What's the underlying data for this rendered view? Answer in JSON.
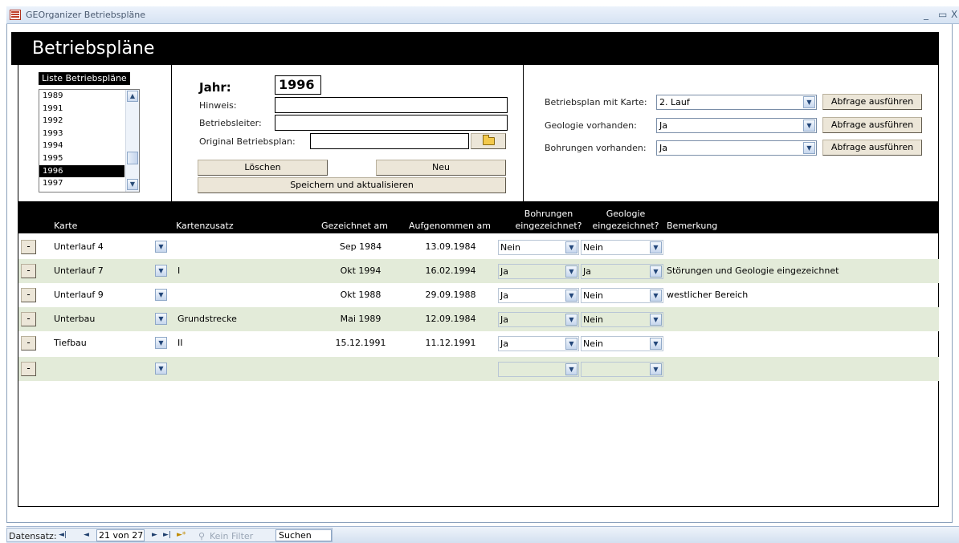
{
  "window": {
    "title": "GEOrganizer Betriebspläne",
    "minimize": "_",
    "maximize": "▭",
    "close": "X"
  },
  "header": {
    "title": "Betriebspläne"
  },
  "year_list": {
    "caption": "Liste Betriebspläne",
    "items": [
      "1989",
      "1991",
      "1992",
      "1993",
      "1994",
      "1995",
      "1996",
      "1997"
    ],
    "selected": "1996"
  },
  "form": {
    "year_label": "Jahr:",
    "year_value": "1996",
    "hinweis_label": "Hinweis:",
    "hinweis_value": "",
    "betriebsleiter_label": "Betriebsleiter:",
    "betriebsleiter_value": "",
    "original_label": "Original Betriebsplan:",
    "original_value": "",
    "delete_label": "Löschen",
    "new_label": "Neu",
    "save_label": "Speichern und aktualisieren"
  },
  "queries": [
    {
      "label": "Betriebsplan mit Karte:",
      "value": "2. Lauf",
      "button": "Abfrage ausführen"
    },
    {
      "label": "Geologie vorhanden:",
      "value": "Ja",
      "button": "Abfrage ausführen"
    },
    {
      "label": "Bohrungen vorhanden:",
      "value": "Ja",
      "button": "Abfrage ausführen"
    }
  ],
  "table": {
    "columns": {
      "karte": "Karte",
      "zusatz": "Kartenzusatz",
      "gezeichnet": "Gezeichnet am",
      "aufgenommen": "Aufgenommen am",
      "bohrungen_1": "Bohrungen",
      "bohrungen_2": "eingezeichnet?",
      "geologie_1": "Geologie",
      "geologie_2": "eingezeichnet?",
      "bemerkung": "Bemerkung"
    },
    "delete_glyph": "-",
    "rows": [
      {
        "karte": "Unterlauf 4",
        "zusatz": "",
        "gezeichnet": "Sep 1984",
        "aufgenommen": "13.09.1984",
        "bohrungen": "Nein",
        "geologie": "Nein",
        "bemerkung": ""
      },
      {
        "karte": "Unterlauf 7",
        "zusatz": "I",
        "gezeichnet": "Okt 1994",
        "aufgenommen": "16.02.1994",
        "bohrungen": "Ja",
        "geologie": "Ja",
        "bemerkung": "Störungen und Geologie eingezeichnet"
      },
      {
        "karte": "Unterlauf 9",
        "zusatz": "",
        "gezeichnet": "Okt 1988",
        "aufgenommen": "29.09.1988",
        "bohrungen": "Ja",
        "geologie": "Nein",
        "bemerkung": "westlicher Bereich"
      },
      {
        "karte": "Unterbau",
        "zusatz": "Grundstrecke",
        "gezeichnet": "Mai 1989",
        "aufgenommen": "12.09.1984",
        "bohrungen": "Ja",
        "geologie": "Nein",
        "bemerkung": ""
      },
      {
        "karte": "Tiefbau",
        "zusatz": "II",
        "gezeichnet": "15.12.1991",
        "aufgenommen": "11.12.1991",
        "bohrungen": "Ja",
        "geologie": "Nein",
        "bemerkung": ""
      },
      {
        "karte": "",
        "zusatz": "",
        "gezeichnet": "",
        "aufgenommen": "",
        "bohrungen": "",
        "geologie": "",
        "bemerkung": ""
      }
    ]
  },
  "statusbar": {
    "label": "Datensatz:",
    "first": "◄|",
    "prev": "◄",
    "record": "21 von 27",
    "next": "►",
    "last": "►|",
    "new": "►*",
    "filter": "Kein Filter",
    "search": "Suchen"
  },
  "colors": {
    "alt_row": "#e3ebd9",
    "header_bg": "#000000",
    "button_face": "#ece6d8"
  }
}
